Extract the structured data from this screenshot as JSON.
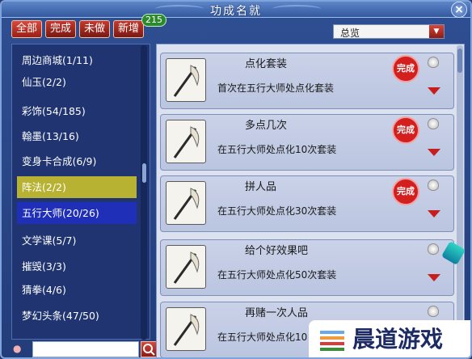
{
  "window": {
    "title": "功成名就"
  },
  "filter_tabs": [
    "全部",
    "完成",
    "未做",
    "新增"
  ],
  "count_badge": "215",
  "dropdown": {
    "value": "总览"
  },
  "sidebar": {
    "items": [
      {
        "label": "周边商城(1/11)"
      },
      {
        "label": "仙玉(2/2)"
      },
      {
        "label": "彩饰(54/185)"
      },
      {
        "label": "翰墨(13/16)"
      },
      {
        "label": "变身卡合成(6/9)"
      },
      {
        "label": "阵法(2/2)"
      },
      {
        "label": "五行大师(20/26)"
      },
      {
        "label": "文学课(5/7)"
      },
      {
        "label": "摧毁(3/3)"
      },
      {
        "label": "猜拳(4/6)"
      },
      {
        "label": "梦幻头条(47/50)"
      }
    ]
  },
  "achievements": [
    {
      "title": "点化套装",
      "desc": "首次在五行大师处点化套装",
      "completed": true,
      "stamp": "完成"
    },
    {
      "title": "多点几次",
      "desc": "在五行大师处点化10次套装",
      "completed": true,
      "stamp": "完成"
    },
    {
      "title": "拼人品",
      "desc": "在五行大师处点化30次套装",
      "completed": true,
      "stamp": "完成"
    },
    {
      "title": "给个好效果吧",
      "desc": "在五行大师处点化50次套装",
      "completed": false,
      "stamp": ""
    },
    {
      "title": "再赌一次人品",
      "desc": "在五行大师处点化10",
      "completed": false,
      "stamp": ""
    }
  ],
  "watermark": {
    "text": "晨道游戏"
  },
  "colors": {
    "accent_red": "#c81d1d",
    "highlight_yellow": "#b8b233",
    "highlight_blue": "#1f2fb8"
  }
}
